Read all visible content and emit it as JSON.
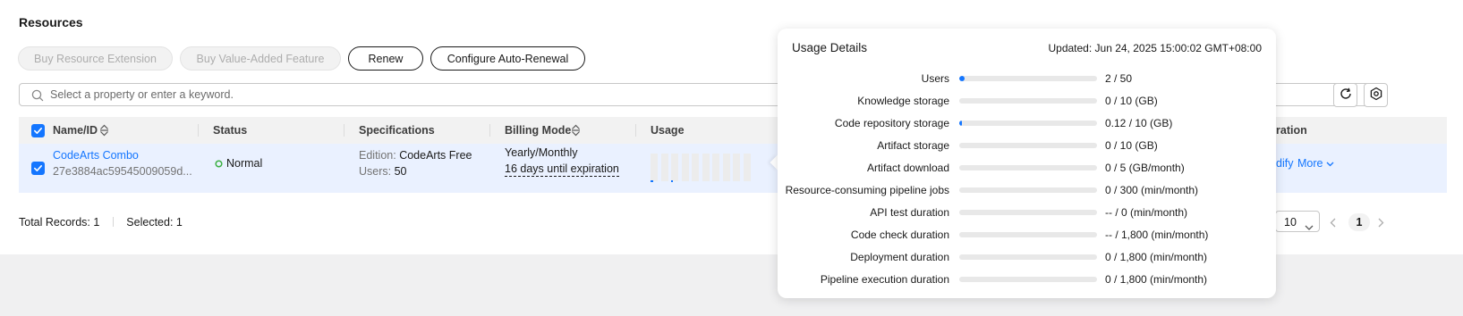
{
  "section": {
    "title": "Resources"
  },
  "toolbar": {
    "buy_resource_extension": "Buy Resource Extension",
    "buy_value_added_feature": "Buy Value-Added Feature",
    "renew": "Renew",
    "configure_auto_renewal": "Configure Auto-Renewal"
  },
  "search": {
    "placeholder": "Select a property or enter a keyword."
  },
  "table": {
    "columns": {
      "name_id": "Name/ID",
      "status": "Status",
      "specifications": "Specifications",
      "billing_mode": "Billing Mode",
      "usage": "Usage",
      "expiration_partial": "ration"
    },
    "row": {
      "name": "CodeArts Combo",
      "id": "27e3884ac59545009059d...",
      "status": "Normal",
      "edition_label": "Edition:",
      "edition_value": "CodeArts Free",
      "users_label": "Users:",
      "users_value": "50",
      "billing_mode": "Yearly/Monthly",
      "expiration": "16 days until expiration",
      "modify_partial": "dify",
      "more": "More"
    },
    "usage_sparkline_filled": [
      0.4,
      0,
      0.3,
      0,
      0,
      0,
      0,
      0,
      0,
      0
    ]
  },
  "footer": {
    "total_records": "Total Records: 1",
    "selected": "Selected: 1",
    "page_size": "10",
    "current_page": "1"
  },
  "usage_details": {
    "title": "Usage Details",
    "updated": "Updated: Jun 24, 2025 15:00:02 GMT+08:00",
    "rows": [
      {
        "label": "Users",
        "value": "2 / 50",
        "fraction": 0.04
      },
      {
        "label": "Knowledge storage",
        "value": "0 / 10 (GB)",
        "fraction": 0
      },
      {
        "label": "Code repository storage",
        "value": "0.12 / 10 (GB)",
        "fraction": 0.012
      },
      {
        "label": "Artifact storage",
        "value": "0 / 10 (GB)",
        "fraction": 0
      },
      {
        "label": "Artifact download",
        "value": "0 / 5 (GB/month)",
        "fraction": 0
      },
      {
        "label": "Resource-consuming pipeline jobs",
        "value": "0 / 300 (min/month)",
        "fraction": 0
      },
      {
        "label": "API test duration",
        "value": "-- / 0 (min/month)",
        "fraction": 0
      },
      {
        "label": "Code check duration",
        "value": "-- / 1,800 (min/month)",
        "fraction": 0
      },
      {
        "label": "Deployment duration",
        "value": "0 / 1,800 (min/month)",
        "fraction": 0
      },
      {
        "label": "Pipeline execution duration",
        "value": "0 / 1,800 (min/month)",
        "fraction": 0
      }
    ]
  },
  "colors": {
    "accent": "#1476ff",
    "status_normal": "#3cb043"
  }
}
